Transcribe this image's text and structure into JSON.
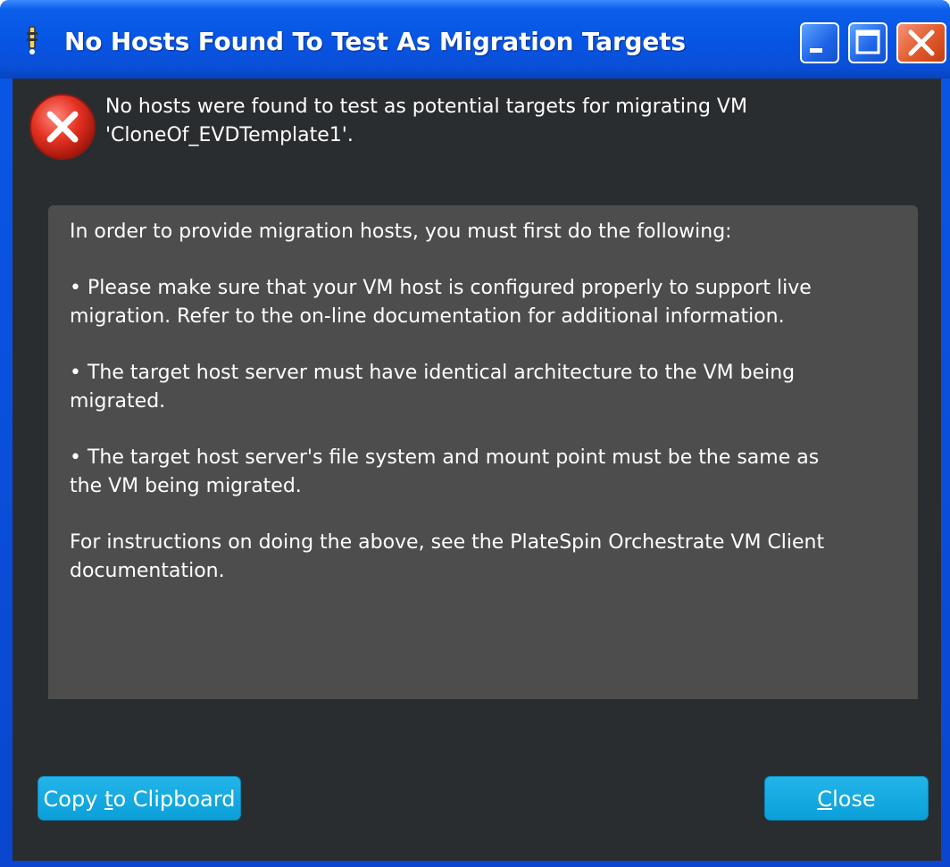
{
  "window": {
    "title": "No Hosts Found To Test As Migration Targets"
  },
  "titlebar_buttons": {
    "minimize_icon": "minimize-icon",
    "maximize_icon": "maximize-icon",
    "close_icon": "close-icon"
  },
  "message": {
    "icon": "error-icon",
    "line1": "No hosts were found to test as potential targets for migrating VM",
    "line2": "'CloneOf_EVDTemplate1'."
  },
  "details": {
    "intro": "In order to provide migration hosts, you must first do the following:",
    "bullet1_line1": "• Please make sure that your VM host is configured properly to support live",
    "bullet1_line2": "migration.  Refer to the on-line documentation for additional information.",
    "bullet2_line1": "• The target host server must have identical architecture to the VM being",
    "bullet2_line2": "migrated.",
    "bullet3_line1": "• The target host server's file system and mount point must be the same as",
    "bullet3_line2": "the VM being migrated.",
    "footer_line1": "For instructions on doing the above, see the PlateSpin Orchestrate VM Client",
    "footer_line2": "documentation."
  },
  "buttons": {
    "copy_prefix": "Copy ",
    "copy_mnemonic": "t",
    "copy_suffix": "o Clipboard",
    "close_mnemonic": "C",
    "close_suffix": "lose"
  },
  "colors": {
    "title_bar": "#0754e3",
    "client_bg": "#2a2d30",
    "details_bg": "#4d4d4d",
    "button_accent": "#13aae0"
  }
}
